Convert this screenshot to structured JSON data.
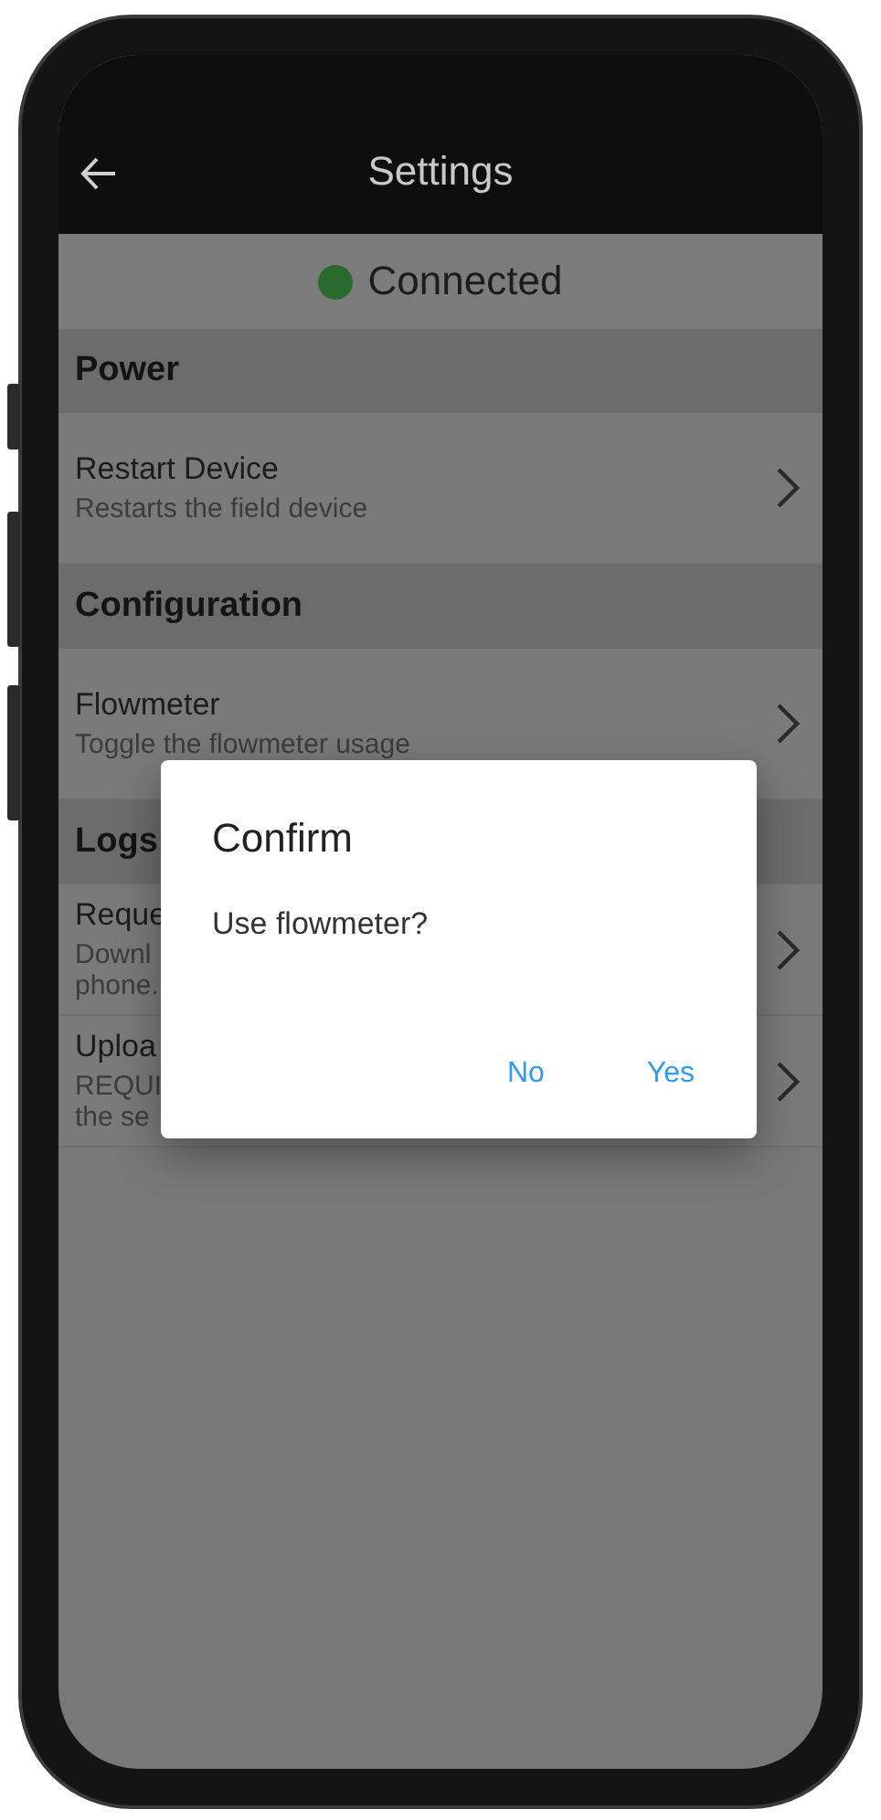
{
  "header": {
    "title": "Settings"
  },
  "status": {
    "label": "Connected",
    "connected": true
  },
  "sections": [
    {
      "title": "Power",
      "items": [
        {
          "title": "Restart Device",
          "subtitle_lines": [
            "Restarts the field device"
          ]
        }
      ]
    },
    {
      "title": "Configuration",
      "items": [
        {
          "title": "Flowmeter",
          "subtitle_lines": [
            "Toggle the flowmeter usage"
          ]
        }
      ]
    },
    {
      "title": "Logs",
      "items": [
        {
          "title": "Reque",
          "subtitle_lines": [
            "Downl",
            "phone."
          ]
        },
        {
          "title": "Uploa",
          "subtitle_lines": [
            "REQUI",
            "the se"
          ]
        }
      ]
    }
  ],
  "dialog": {
    "title": "Confirm",
    "message": "Use flowmeter?",
    "buttons": [
      "No",
      "Yes"
    ]
  }
}
